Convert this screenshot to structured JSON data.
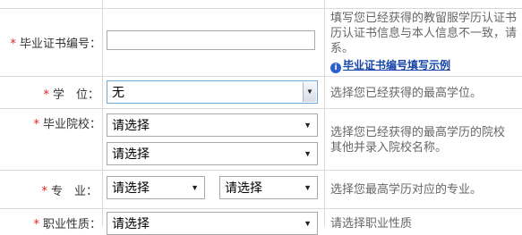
{
  "rows": {
    "cert": {
      "required": "*",
      "label": "毕业证书编号：",
      "input_value": "",
      "help_lines": [
        "填写您已经获得的教留服学历认证书",
        "历认证书信息与本人信息不一致，请",
        "系。"
      ],
      "help_link": "毕业证书编号填写示例",
      "help_link_icon": "info-icon"
    },
    "degree": {
      "required": "*",
      "label": "学　位：",
      "selected": "无",
      "help": "选择您已经获得的最高学位。"
    },
    "college": {
      "required": "*",
      "label": "毕业院校：",
      "select1": "请选择",
      "select2": "请选择",
      "help_lines": [
        "选择您已经获得的最高学历的院校",
        "其他并录入院校名称。"
      ]
    },
    "major": {
      "required": "*",
      "label": "专　业：",
      "select1": "请选择",
      "select2": "请选择",
      "help": "选择您最高学历对应的专业。"
    },
    "job": {
      "required": "*",
      "label": "职业性质：",
      "select1": "请选择",
      "help": "请选择职业性质"
    }
  },
  "colors": {
    "required": "#e02020",
    "link": "#1545a8",
    "help_text": "#666666",
    "grid": "#d9d9d9"
  }
}
